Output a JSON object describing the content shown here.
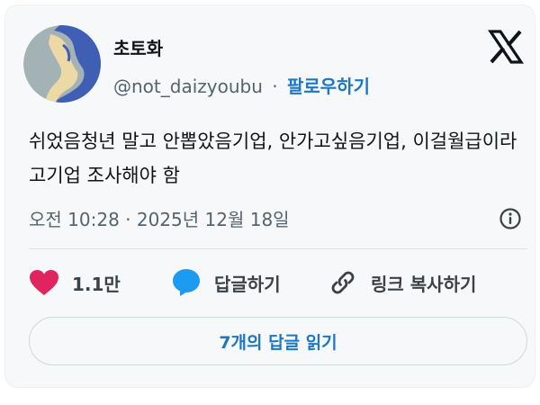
{
  "author": {
    "display_name": "초토화",
    "handle": "@not_daizyoubu",
    "separator": "·",
    "follow_label": "팔로우하기"
  },
  "tweet": {
    "text": "쉬었음청년 말고 안뽑았음기업, 안가고싶음기업, 이걸월급이라고기업 조사해야 함",
    "time": "오전 10:28",
    "date_separator": "·",
    "date": "2025년 12월 18일"
  },
  "actions": {
    "like_count": "1.1만",
    "reply_label": "답글하기",
    "copy_link_label": "링크 복사하기"
  },
  "read_replies_label": "7개의 답글 읽기",
  "icons": {
    "logo": "x-logo-icon",
    "info": "info-icon",
    "like": "heart-icon",
    "reply": "speech-bubble-icon",
    "copy": "link-icon"
  },
  "colors": {
    "accent": "#1d77c2",
    "heart": "#e0245e",
    "reply_bubble": "#1d9bf0",
    "muted_text": "#536471"
  }
}
